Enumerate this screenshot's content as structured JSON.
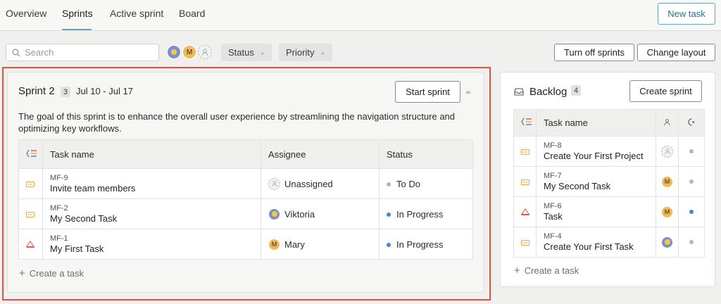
{
  "nav": {
    "tabs": [
      "Overview",
      "Sprints",
      "Active sprint",
      "Board"
    ],
    "new_task_label": "New task"
  },
  "toolbar": {
    "search_placeholder": "Search",
    "avatar_m": "M",
    "status_label": "Status",
    "priority_label": "Priority",
    "turn_off_label": "Turn off sprints",
    "change_layout_label": "Change layout"
  },
  "sprint": {
    "title": "Sprint 2",
    "count": "3",
    "dates": "Jul 10 - Jul 17",
    "start_label": "Start sprint",
    "goal": "The goal of this sprint is to enhance the overall user experience by streamlining the navigation structure and optimizing key workflows.",
    "columns": {
      "task": "Task name",
      "assignee": "Assignee",
      "status": "Status"
    },
    "rows": [
      {
        "key": "MF-9",
        "name": "Invite team members",
        "assignee": "Unassigned",
        "avatar": "",
        "status": "To Do",
        "priority": "medium"
      },
      {
        "key": "MF-2",
        "name": "My Second Task",
        "assignee": "Viktoria",
        "avatar": "",
        "status": "In Progress",
        "priority": "medium"
      },
      {
        "key": "MF-1",
        "name": "My First Task",
        "assignee": "Mary",
        "avatar": "M",
        "status": "In Progress",
        "priority": "high"
      }
    ],
    "create_label": "Create a task"
  },
  "backlog": {
    "title": "Backlog",
    "count": "4",
    "create_sprint_label": "Create sprint",
    "columns": {
      "task": "Task name"
    },
    "rows": [
      {
        "key": "MF-8",
        "name": "Create Your First Project",
        "avatar": "",
        "priority": "medium"
      },
      {
        "key": "MF-7",
        "name": "My Second Task",
        "avatar": "M",
        "priority": "medium"
      },
      {
        "key": "MF-6",
        "name": "Task",
        "avatar": "M",
        "priority": "high"
      },
      {
        "key": "MF-4",
        "name": "Create Your First Task",
        "avatar": "",
        "priority": "medium"
      }
    ],
    "create_label": "Create a task"
  },
  "colors": {
    "accent": "#6ea3b8",
    "highlight_border": "#e4533a",
    "todo": "#b5b5b5",
    "in_progress": "#4a7fe0",
    "priority_medium": "#f0a93c",
    "priority_high": "#e0584a"
  }
}
